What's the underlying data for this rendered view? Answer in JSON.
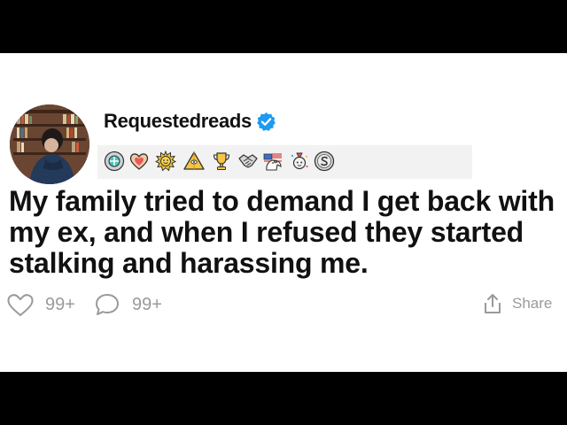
{
  "post": {
    "username": "Requestedreads",
    "title": "My family tried to demand I get back with my ex, and when I refused they started stalking and harassing me.",
    "likes": "99+",
    "comments": "99+",
    "share_label": "Share"
  },
  "awards": [
    "silver-gear-award-icon",
    "heart-award-icon",
    "sun-face-award-icon",
    "pyramid-award-icon",
    "trophy-award-icon",
    "handshake-award-icon",
    "eagle-award-icon",
    "party-award-icon",
    "silver-s-coin-icon"
  ],
  "colors": {
    "verified": "#1d9bf0",
    "muted": "#9a9a9a",
    "text": "#111111"
  }
}
